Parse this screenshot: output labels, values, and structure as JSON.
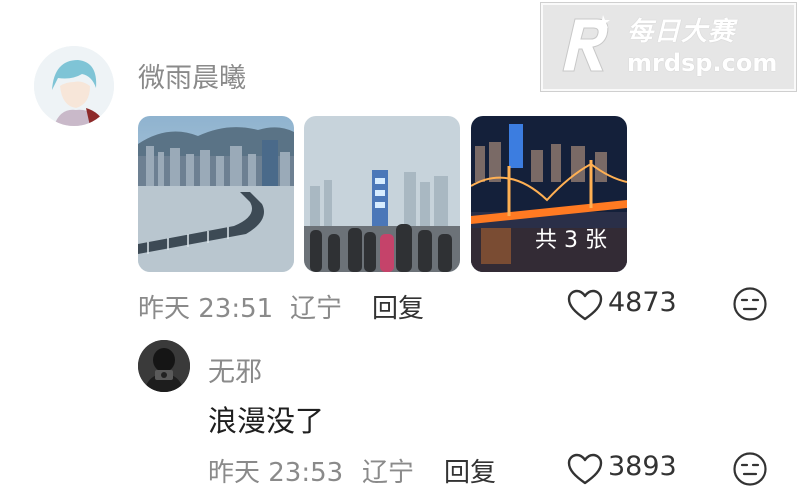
{
  "watermark": {
    "title": "每日大赛",
    "url": "mrdsp.com"
  },
  "comment1": {
    "username": "微雨晨曦",
    "timestamp": "昨天 23:51",
    "location": "辽宁",
    "reply_label": "回复",
    "like_count": "4873",
    "more_images_label": "共 3 张",
    "like_icon": "heart-outline-icon",
    "reaction_icon": "neutral-face-icon"
  },
  "comment2": {
    "username": "无邪",
    "text": "浪漫没了",
    "timestamp": "昨天 23:53",
    "location": "辽宁",
    "reply_label": "回复",
    "like_count": "3893",
    "like_icon": "heart-outline-icon",
    "reaction_icon": "neutral-face-icon"
  }
}
